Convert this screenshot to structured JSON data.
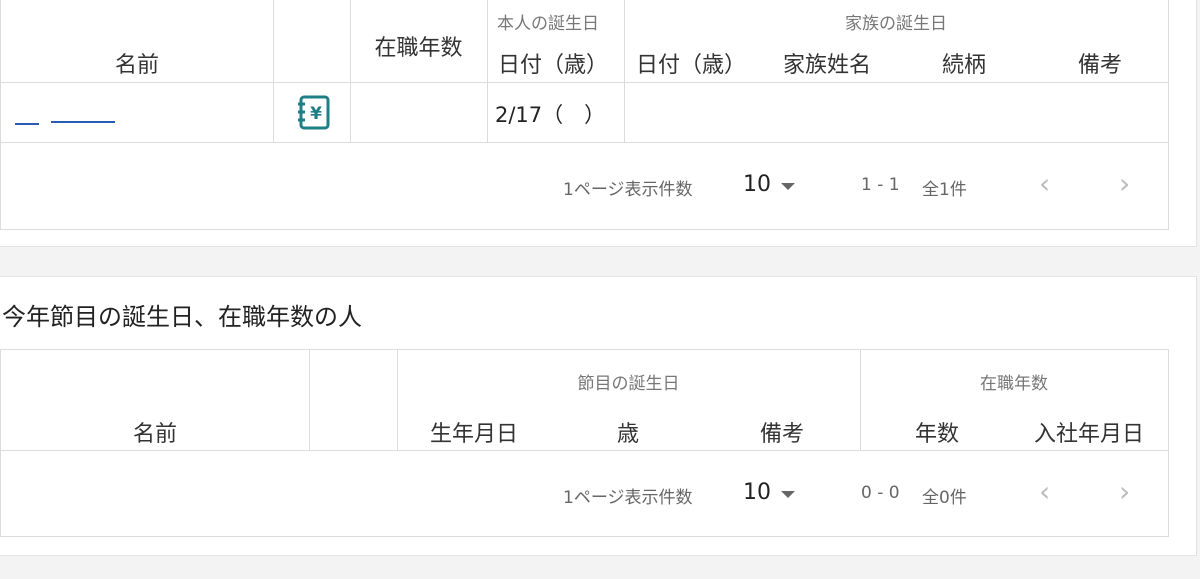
{
  "table1": {
    "headers": {
      "name": "名前",
      "tenure": "在職年数",
      "self_birthday_group": "本人の誕生日",
      "self_date_age": "日付（歳）",
      "family_birthday_group": "家族の誕生日",
      "family_date_age": "日付（歳）",
      "family_name": "家族姓名",
      "relation": "続柄",
      "note": "備考"
    },
    "row": {
      "date": "2/17（　）",
      "icon": "ledger-yen-icon"
    },
    "pagination": {
      "per_page_label": "1ページ表示件数",
      "per_page_value": "10",
      "range": "1 - 1",
      "total": "全1件"
    }
  },
  "section2": {
    "title": "今年節目の誕生日、在職年数の人"
  },
  "table2": {
    "headers": {
      "name": "名前",
      "milestone_group": "節目の誕生日",
      "birthdate": "生年月日",
      "age": "歳",
      "note": "備考",
      "tenure_group": "在職年数",
      "years": "年数",
      "join_date": "入社年月日"
    },
    "pagination": {
      "per_page_label": "1ページ表示件数",
      "per_page_value": "10",
      "range": "0 - 0",
      "total": "全0件"
    }
  },
  "colors": {
    "accent_teal": "#1e7f86",
    "link_blue": "#2b5bb5"
  }
}
